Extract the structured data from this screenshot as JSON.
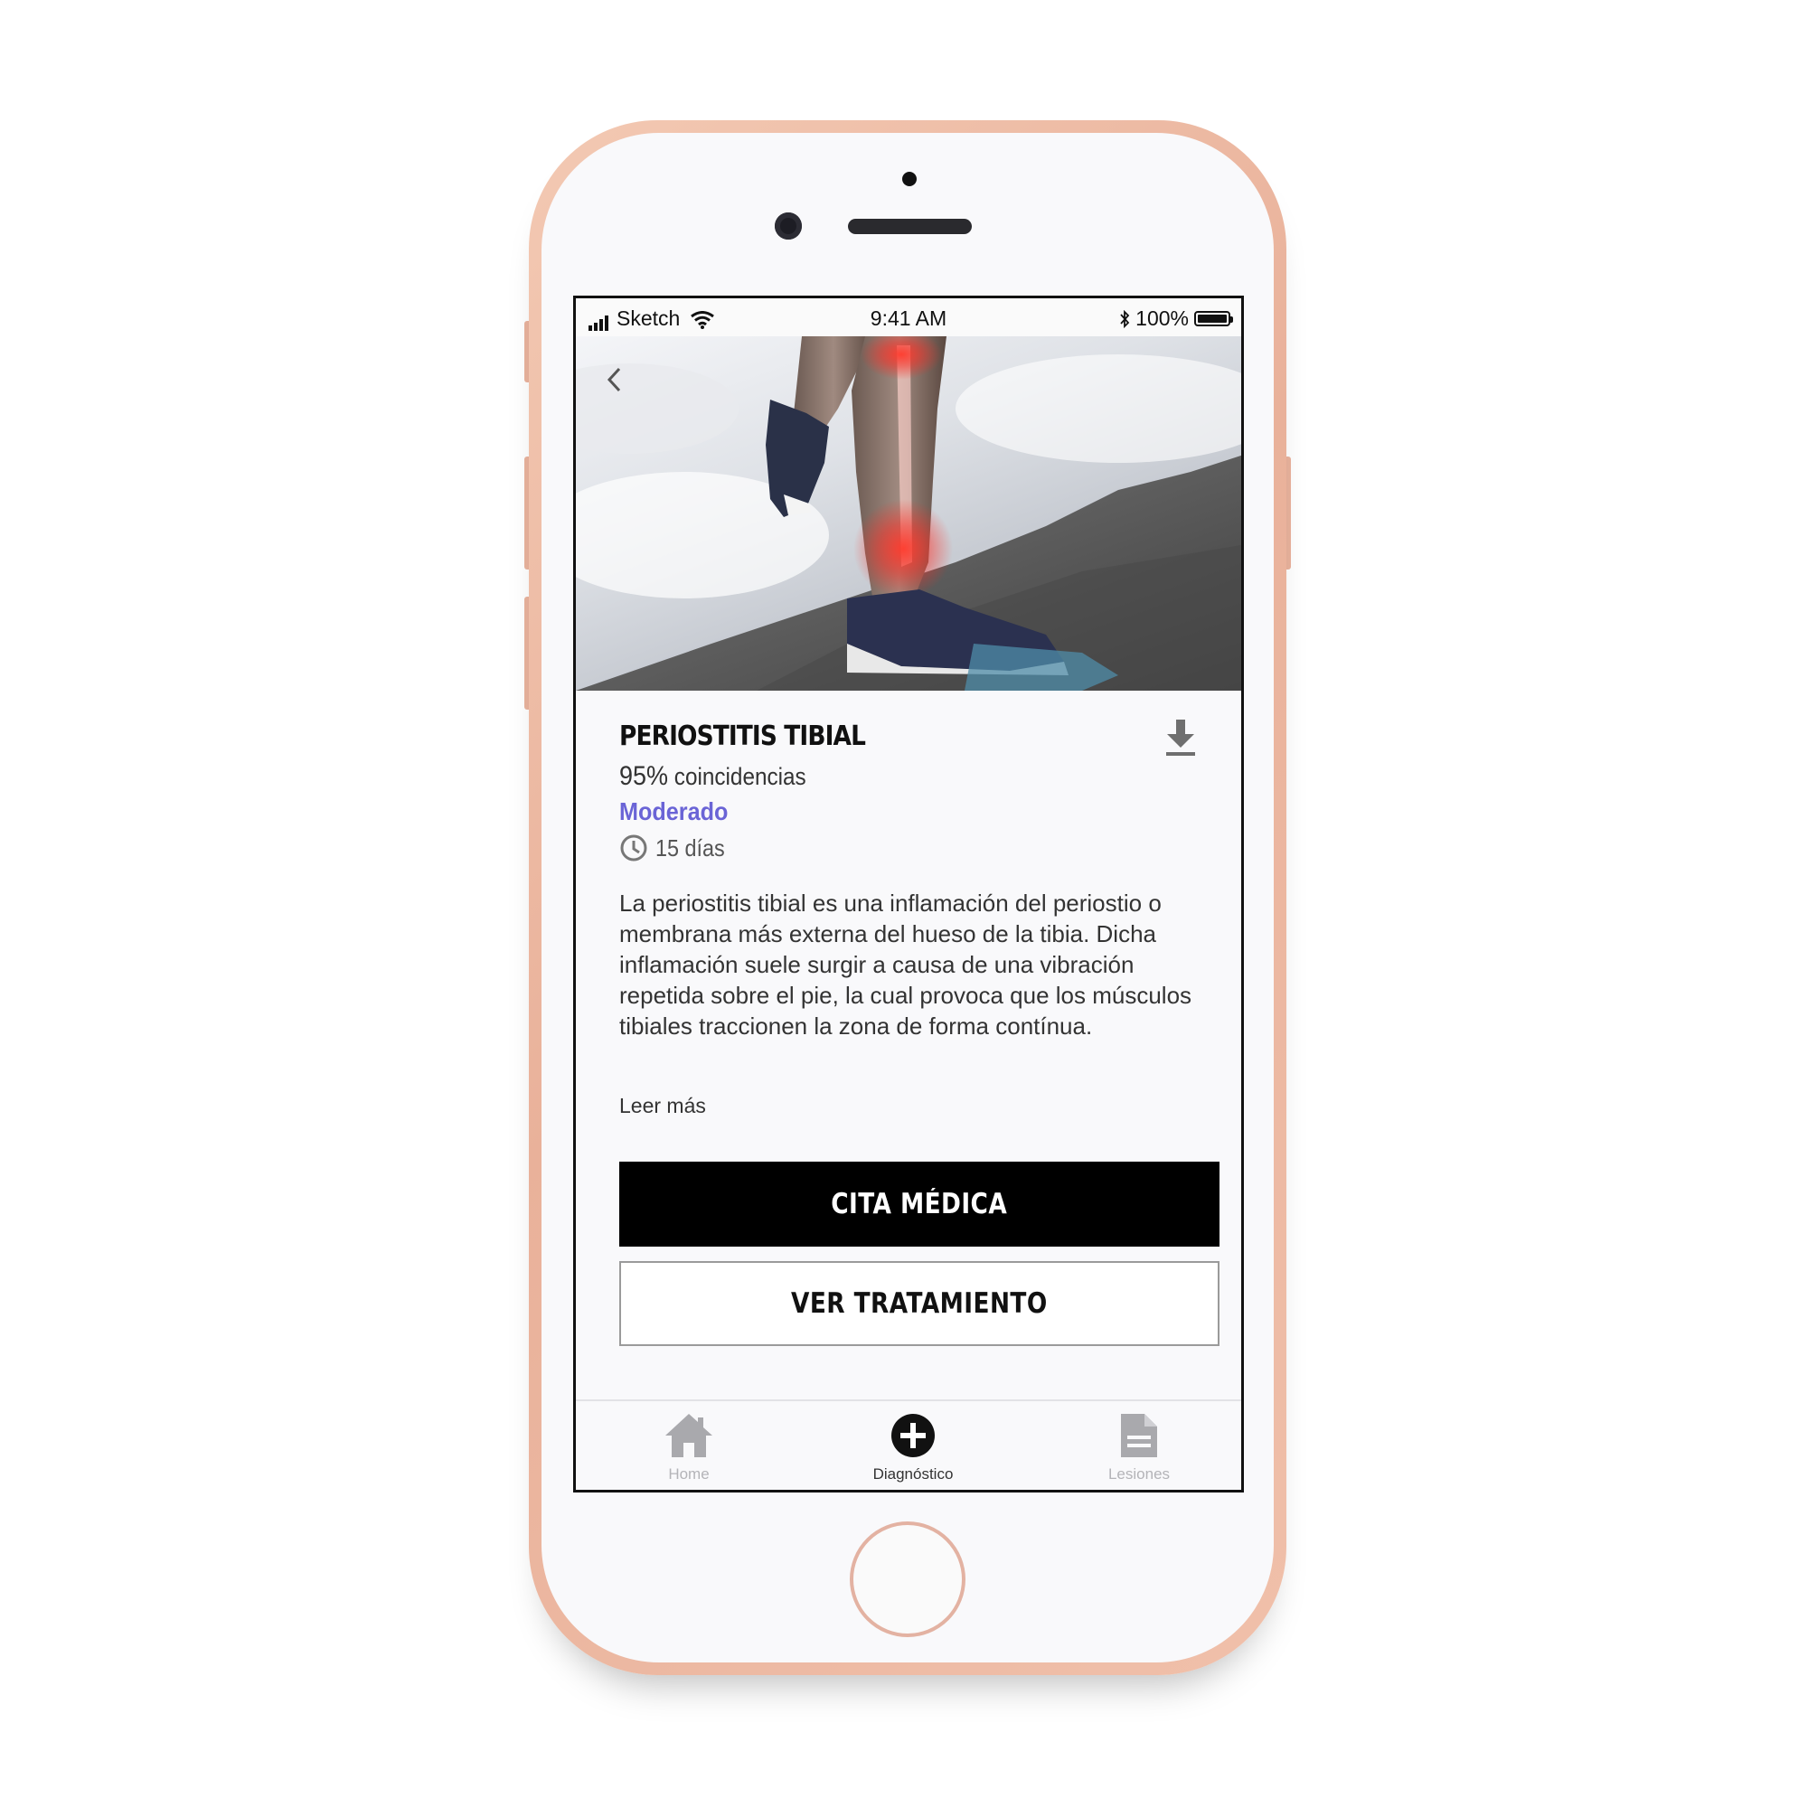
{
  "status_bar": {
    "carrier": "Sketch",
    "time": "9:41 AM",
    "battery": "100%"
  },
  "hero": {
    "image_icon": "runner-shin-image",
    "back_icon": "chevron-left-icon"
  },
  "condition": {
    "title": "PERIOSTITIS TIBIAL",
    "match_percent": "95%",
    "match_label": "coincidencias",
    "severity": "Moderado",
    "duration": "15 días",
    "description": "La periostitis tibial es una inflamación del periostio o membrana más externa del hueso de la tibia. Dicha inflamación suele surgir a causa de una vibración repetida sobre el pie, la cual provoca que los músculos tibiales traccionen la zona de forma contínua.",
    "read_more": "Leer más",
    "download_icon": "download-icon"
  },
  "actions": {
    "primary": "CITA MÉDICA",
    "secondary": "VER TRATAMIENTO"
  },
  "tabbar": {
    "items": [
      {
        "label": "Home",
        "icon": "home-icon",
        "active": false
      },
      {
        "label": "Diagnóstico",
        "icon": "plus-circle-icon",
        "active": true
      },
      {
        "label": "Lesiones",
        "icon": "document-icon",
        "active": false
      }
    ]
  },
  "colors": {
    "accent": "#6a64d6",
    "primary_button": "#000000",
    "frame": "#e9b19a",
    "inactive_tab": "#a9a9ad"
  }
}
